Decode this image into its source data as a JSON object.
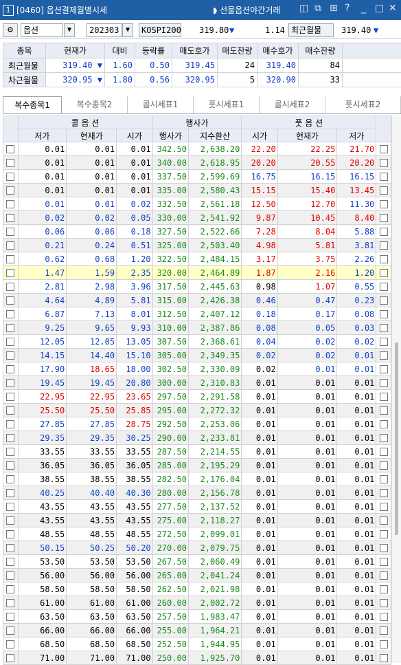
{
  "window": {
    "number": "1",
    "title": "[0460] 옵션결제월별시세",
    "night_link": "선물옵션야간거래",
    "icons": [
      "window-icon",
      "pin-icon",
      "bookmark-icon",
      "help-icon",
      "minimize-icon",
      "maximize-icon",
      "close-icon"
    ]
  },
  "toolbar": {
    "gear": "⚙",
    "type": "옵션",
    "month": "202303",
    "index_name": "KOSPI200",
    "index_value": "319.80",
    "index_arrow": "▼",
    "index_change": "1.14",
    "nearest_label": "최근월물",
    "nearest_value": "319.40",
    "nearest_arrow": "▼"
  },
  "summary": {
    "headers": [
      "종목",
      "현재가",
      "대비",
      "등락률",
      "매도호가",
      "매도잔량",
      "매수호가",
      "매수잔량"
    ],
    "rows": [
      {
        "name": "최근월물",
        "price": "319.40",
        "arrow": "▼",
        "change": "1.60",
        "rate": "0.50",
        "ask": "319.45",
        "ask_qty": "24",
        "bid": "319.40",
        "bid_qty": "84"
      },
      {
        "name": "차근월물",
        "price": "320.95",
        "arrow": "▼",
        "change": "1.80",
        "rate": "0.56",
        "ask": "320.95",
        "ask_qty": "5",
        "bid": "320.90",
        "bid_qty": "33"
      }
    ]
  },
  "tabs": [
    "복수종목1",
    "복수종목2",
    "콜시세표1",
    "풋시세표1",
    "콜시세표2",
    "풋시세표2"
  ],
  "grid": {
    "group_call": "콜  옵  션",
    "group_strike": "행사가",
    "group_put": "풋  옵  션",
    "cols": [
      "저가",
      "현재가",
      "시가",
      "행사가",
      "지수환산",
      "시가",
      "현재가",
      "저가"
    ],
    "rows": [
      [
        "0.01",
        "0.01",
        "0.01",
        "342.50",
        "2,638.20",
        "22.20",
        "22.25",
        "21.70"
      ],
      [
        "0.01",
        "0.01",
        "0.01",
        "340.00",
        "2,618.95",
        "20.20",
        "20.55",
        "20.20"
      ],
      [
        "0.01",
        "0.01",
        "0.01",
        "337.50",
        "2,599.69",
        "16.75",
        "16.15",
        "16.15"
      ],
      [
        "0.01",
        "0.01",
        "0.01",
        "335.00",
        "2,580.43",
        "15.15",
        "15.40",
        "13.45"
      ],
      [
        "0.01",
        "0.01",
        "0.02",
        "332.50",
        "2,561.18",
        "12.50",
        "12.70",
        "11.30"
      ],
      [
        "0.02",
        "0.02",
        "0.05",
        "330.00",
        "2,541.92",
        "9.87",
        "10.45",
        "8.40"
      ],
      [
        "0.06",
        "0.06",
        "0.18",
        "327.50",
        "2,522.66",
        "7.28",
        "8.04",
        "5.88"
      ],
      [
        "0.21",
        "0.24",
        "0.51",
        "325.00",
        "2,503.40",
        "4.98",
        "5.81",
        "3.81"
      ],
      [
        "0.62",
        "0.68",
        "1.20",
        "322.50",
        "2,484.15",
        "3.17",
        "3.75",
        "2.26"
      ],
      [
        "1.47",
        "1.59",
        "2.35",
        "320.00",
        "2,464.89",
        "1.87",
        "2.16",
        "1.20"
      ],
      [
        "2.81",
        "2.98",
        "3.96",
        "317.50",
        "2,445.63",
        "0.98",
        "1.07",
        "0.55"
      ],
      [
        "4.64",
        "4.89",
        "5.81",
        "315.00",
        "2,426.38",
        "0.46",
        "0.47",
        "0.23"
      ],
      [
        "6.87",
        "7.13",
        "8.01",
        "312.50",
        "2,407.12",
        "0.18",
        "0.17",
        "0.08"
      ],
      [
        "9.25",
        "9.65",
        "9.93",
        "310.00",
        "2,387.86",
        "0.08",
        "0.05",
        "0.03"
      ],
      [
        "12.05",
        "12.05",
        "13.05",
        "307.50",
        "2,368.61",
        "0.04",
        "0.02",
        "0.02"
      ],
      [
        "14.15",
        "14.40",
        "15.10",
        "305.00",
        "2,349.35",
        "0.02",
        "0.02",
        "0.01"
      ],
      [
        "17.90",
        "18.65",
        "18.00",
        "302.50",
        "2,330.09",
        "0.02",
        "0.01",
        "0.01"
      ],
      [
        "19.45",
        "19.45",
        "20.80",
        "300.00",
        "2,310.83",
        "0.01",
        "0.01",
        "0.01"
      ],
      [
        "22.95",
        "22.95",
        "23.65",
        "297.50",
        "2,291.58",
        "0.01",
        "0.01",
        "0.01"
      ],
      [
        "25.50",
        "25.50",
        "25.85",
        "295.00",
        "2,272.32",
        "0.01",
        "0.01",
        "0.01"
      ],
      [
        "27.85",
        "27.85",
        "28.75",
        "292.50",
        "2,253.06",
        "0.01",
        "0.01",
        "0.01"
      ],
      [
        "29.35",
        "29.35",
        "30.25",
        "290.00",
        "2,233.81",
        "0.01",
        "0.01",
        "0.01"
      ],
      [
        "33.55",
        "33.55",
        "33.55",
        "287.50",
        "2,214.55",
        "0.01",
        "0.01",
        "0.01"
      ],
      [
        "36.05",
        "36.05",
        "36.05",
        "285.00",
        "2,195.29",
        "0.01",
        "0.01",
        "0.01"
      ],
      [
        "38.55",
        "38.55",
        "38.55",
        "282.50",
        "2,176.04",
        "0.01",
        "0.01",
        "0.01"
      ],
      [
        "40.25",
        "40.40",
        "40.30",
        "280.00",
        "2,156.78",
        "0.01",
        "0.01",
        "0.01"
      ],
      [
        "43.55",
        "43.55",
        "43.55",
        "277.50",
        "2,137.52",
        "0.01",
        "0.01",
        "0.01"
      ],
      [
        "43.55",
        "43.55",
        "43.55",
        "275.00",
        "2,118.27",
        "0.01",
        "0.01",
        "0.01"
      ],
      [
        "48.55",
        "48.55",
        "48.55",
        "272.50",
        "2,099.01",
        "0.01",
        "0.01",
        "0.01"
      ],
      [
        "50.15",
        "50.25",
        "50.20",
        "270.00",
        "2,079.75",
        "0.01",
        "0.01",
        "0.01"
      ],
      [
        "53.50",
        "53.50",
        "53.50",
        "267.50",
        "2,060.49",
        "0.01",
        "0.01",
        "0.01"
      ],
      [
        "56.00",
        "56.00",
        "56.00",
        "265.00",
        "2,041.24",
        "0.01",
        "0.01",
        "0.01"
      ],
      [
        "58.50",
        "58.50",
        "58.50",
        "262.50",
        "2,021.98",
        "0.01",
        "0.01",
        "0.01"
      ],
      [
        "61.00",
        "61.00",
        "61.00",
        "260.00",
        "2,002.72",
        "0.01",
        "0.01",
        "0.01"
      ],
      [
        "63.50",
        "63.50",
        "63.50",
        "257.50",
        "1,983.47",
        "0.01",
        "0.01",
        "0.01"
      ],
      [
        "66.00",
        "66.00",
        "66.00",
        "255.00",
        "1,964.21",
        "0.01",
        "0.01",
        "0.01"
      ],
      [
        "68.50",
        "68.50",
        "68.50",
        "252.50",
        "1,944.95",
        "0.01",
        "0.01",
        "0.01"
      ],
      [
        "71.00",
        "71.00",
        "71.00",
        "250.00",
        "1,925.70",
        "0.01",
        "0.01",
        "0.01"
      ]
    ],
    "colors": {
      "rows": [
        [
          "k",
          "k",
          "k",
          "r",
          "r",
          "r"
        ],
        [
          "k",
          "k",
          "k",
          "r",
          "r",
          "r"
        ],
        [
          "k",
          "k",
          "k",
          "b",
          "b",
          "b"
        ],
        [
          "k",
          "k",
          "k",
          "r",
          "r",
          "r"
        ],
        [
          "b",
          "b",
          "b",
          "r",
          "r",
          "b"
        ],
        [
          "b",
          "b",
          "b",
          "r",
          "r",
          "r"
        ],
        [
          "b",
          "b",
          "b",
          "r",
          "r",
          "b"
        ],
        [
          "b",
          "b",
          "b",
          "r",
          "r",
          "b"
        ],
        [
          "b",
          "b",
          "b",
          "r",
          "r",
          "b"
        ],
        [
          "b",
          "b",
          "b",
          "r",
          "r",
          "b"
        ],
        [
          "b",
          "b",
          "b",
          "k",
          "r",
          "b"
        ],
        [
          "b",
          "b",
          "b",
          "b",
          "b",
          "b"
        ],
        [
          "b",
          "b",
          "b",
          "b",
          "b",
          "b"
        ],
        [
          "b",
          "b",
          "b",
          "b",
          "b",
          "b"
        ],
        [
          "b",
          "b",
          "b",
          "b",
          "b",
          "b"
        ],
        [
          "b",
          "b",
          "b",
          "b",
          "b",
          "b"
        ],
        [
          "b",
          "r",
          "b",
          "k",
          "b",
          "b"
        ],
        [
          "b",
          "b",
          "b",
          "k",
          "k",
          "k"
        ],
        [
          "r",
          "r",
          "r",
          "k",
          "k",
          "k"
        ],
        [
          "r",
          "r",
          "r",
          "k",
          "k",
          "k"
        ],
        [
          "b",
          "b",
          "r",
          "k",
          "k",
          "k"
        ],
        [
          "b",
          "b",
          "b",
          "k",
          "k",
          "k"
        ],
        [
          "k",
          "k",
          "k",
          "k",
          "k",
          "k"
        ],
        [
          "k",
          "k",
          "k",
          "k",
          "k",
          "k"
        ],
        [
          "k",
          "k",
          "k",
          "k",
          "k",
          "k"
        ],
        [
          "b",
          "b",
          "b",
          "k",
          "k",
          "k"
        ],
        [
          "k",
          "k",
          "k",
          "k",
          "k",
          "k"
        ],
        [
          "k",
          "k",
          "k",
          "k",
          "k",
          "k"
        ],
        [
          "k",
          "k",
          "k",
          "k",
          "k",
          "k"
        ],
        [
          "b",
          "b",
          "b",
          "k",
          "k",
          "k"
        ],
        [
          "k",
          "k",
          "k",
          "k",
          "k",
          "k"
        ],
        [
          "k",
          "k",
          "k",
          "k",
          "k",
          "k"
        ],
        [
          "k",
          "k",
          "k",
          "k",
          "k",
          "k"
        ],
        [
          "k",
          "k",
          "k",
          "k",
          "k",
          "k"
        ],
        [
          "k",
          "k",
          "k",
          "k",
          "k",
          "k"
        ],
        [
          "k",
          "k",
          "k",
          "k",
          "k",
          "k"
        ],
        [
          "k",
          "k",
          "k",
          "k",
          "k",
          "k"
        ],
        [
          "k",
          "k",
          "k",
          "k",
          "k",
          "k"
        ]
      ]
    },
    "highlight_strike": "320.00"
  },
  "palette": {
    "blue": "#1240c8",
    "red": "#e20000",
    "green": "#1a8a1a",
    "title_bg": "#1f5fa6"
  }
}
